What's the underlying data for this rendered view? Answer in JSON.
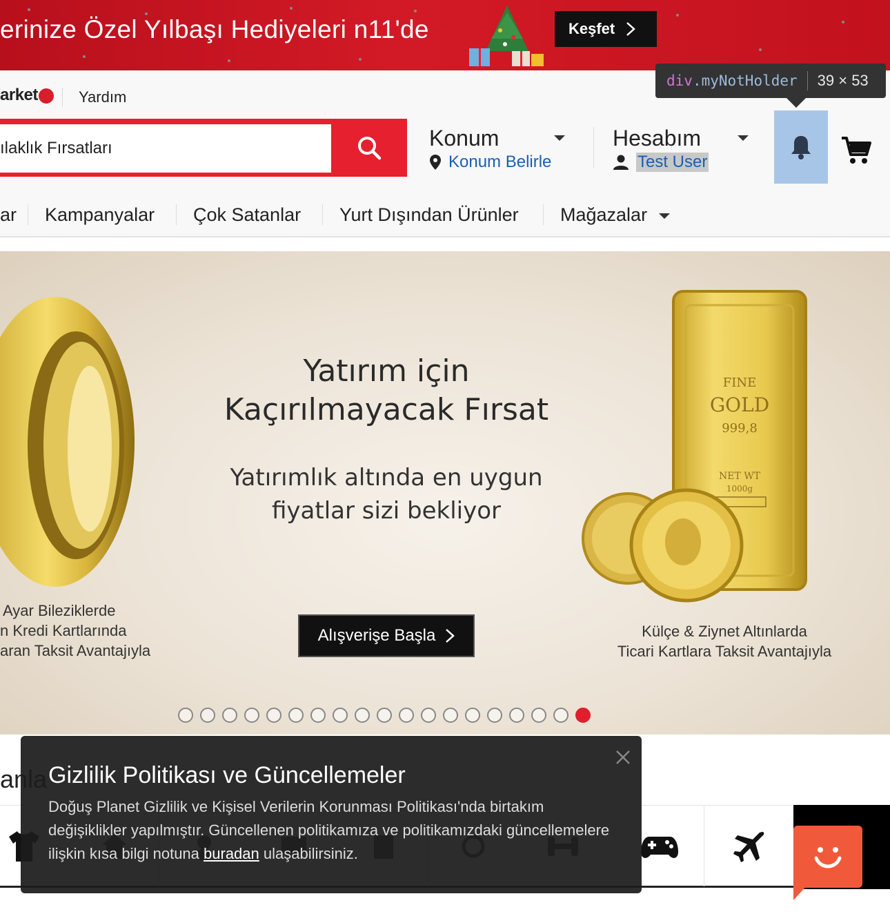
{
  "promo": {
    "text": "erinize Özel Yılbaşı Hediyeleri n11'de",
    "cta_label": "Keşfet"
  },
  "header": {
    "logo_text": "arket",
    "help_label": "Yardım",
    "search_value": "ılaklık Fırsatları",
    "location": {
      "title": "Konum",
      "link": "Konum Belirle"
    },
    "account": {
      "title": "Hesabım",
      "user": "Test User"
    }
  },
  "devtools_tooltip": {
    "tag": "div",
    "class": ".myNotHolder",
    "dimensions": "39 × 53"
  },
  "nav": {
    "items": [
      "ar",
      "Kampanyalar",
      "Çok Satanlar",
      "Yurt Dışından Ürünler",
      "Mağazalar"
    ]
  },
  "hero": {
    "title_line1": "Yatırım için",
    "title_line2": "Kaçırılmayacak Fırsat",
    "subtitle_line1": "Yatırımlık altında en uygun",
    "subtitle_line2": "fiyatlar sizi bekliyor",
    "cta_label": "Alışverişe Başla",
    "left_caption": [
      "Ayar Bileziklerde",
      "n Kredi Kartlarında",
      "aran Taksit Avantajıyla"
    ],
    "right_caption": [
      "Külçe & Ziynet Altınlarda",
      "Ticari Kartlara Taksit Avantajıyla"
    ],
    "goldbar": {
      "line1": "FINE",
      "line2": "GOLD",
      "line3": "999,8",
      "line4": "NET WT",
      "line5": "1000g"
    },
    "slide_count": 19,
    "active_slide": 18
  },
  "section": {
    "title": "anla"
  },
  "categories": {
    "icons": [
      "tshirt-icon",
      "home-icon",
      "baby-icon",
      "watch-icon",
      "dumbbell-icon",
      "gamepad-icon",
      "airplane-icon"
    ]
  },
  "popup": {
    "title": "Gizlilik Politikası ve Güncellemeler",
    "body_before": "Doğuş Planet Gizlilik ve Kişisel Verilerin Korunması Politikası'nda birtakım değişiklikler yapılmıştır. Güncellenen politikamıza ve politikamızdaki güncellemelere ilişkin kısa bilgi notuna ",
    "link_label": "buradan",
    "body_after": " ulaşabilirsiniz."
  },
  "colors": {
    "brand_red": "#e6202e",
    "highlight_blue": "#a7c6e7",
    "chat_orange": "#f05a3a"
  }
}
